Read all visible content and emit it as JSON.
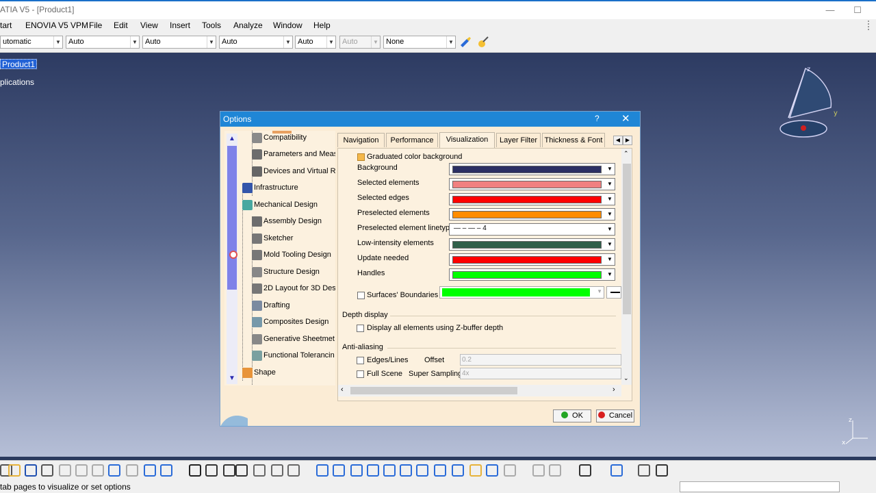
{
  "window": {
    "title": "ATIA V5 - [Product1]",
    "minimize": "—",
    "maximize": "☐"
  },
  "menubar": [
    "tart",
    "ENOVIA V5 VPM",
    "File",
    "Edit",
    "View",
    "Insert",
    "Tools",
    "Analyze",
    "Window",
    "Help"
  ],
  "toolbar_combos": [
    {
      "value": "utomatic",
      "disabled": false
    },
    {
      "value": "Auto",
      "disabled": false
    },
    {
      "value": "Auto",
      "disabled": false
    },
    {
      "value": "Auto",
      "disabled": false
    },
    {
      "value": "Auto",
      "disabled": false
    },
    {
      "value": "Auto",
      "disabled": true
    },
    {
      "value": "None",
      "disabled": false
    }
  ],
  "tree": {
    "root": "Product1",
    "applications": "plications"
  },
  "compass": {
    "z": "z",
    "y": "y"
  },
  "axes": {
    "z": "z",
    "x": "x"
  },
  "dialog": {
    "title": "Options",
    "help": "?",
    "close": "✕",
    "left_tree": [
      {
        "label": "Compatibility",
        "icon": "compatibility-icon"
      },
      {
        "label": "Parameters and Meas",
        "icon": "parameters-icon"
      },
      {
        "label": "Devices and Virtual R",
        "icon": "devices-icon"
      },
      {
        "label": "Infrastructure",
        "icon": "infrastructure-icon"
      },
      {
        "label": "Mechanical Design",
        "icon": "mechanical-design-icon"
      },
      {
        "label": "Assembly Design",
        "icon": "assembly-icon"
      },
      {
        "label": "Sketcher",
        "icon": "sketcher-icon"
      },
      {
        "label": "Mold Tooling Design",
        "icon": "mold-tooling-icon"
      },
      {
        "label": "Structure Design",
        "icon": "structure-icon"
      },
      {
        "label": "2D Layout for 3D Des",
        "icon": "layout-icon"
      },
      {
        "label": "Drafting",
        "icon": "drafting-icon"
      },
      {
        "label": "Composites Design",
        "icon": "composites-icon"
      },
      {
        "label": "Generative Sheetmet",
        "icon": "sheetmetal-icon"
      },
      {
        "label": "Functional Tolerancin",
        "icon": "tolerancing-icon"
      },
      {
        "label": "Shape",
        "icon": "shape-icon"
      }
    ],
    "tabs": [
      "Navigation",
      "Performance",
      "Visualization",
      "Layer Filter",
      "Thickness & Font"
    ],
    "active_tab": "Visualization",
    "graduated_label": "Graduated color background",
    "color_rows": [
      {
        "label": "Background",
        "color": "#2b2f63"
      },
      {
        "label": "Selected elements",
        "color": "#f08080"
      },
      {
        "label": "Selected edges",
        "color": "#ff0000"
      },
      {
        "label": "Preselected elements",
        "color": "#ff8c00"
      },
      {
        "label": "Preselected element linetype",
        "linetype": "— – — –   4"
      },
      {
        "label": "Low-intensity elements",
        "color": "#2f5f4a"
      },
      {
        "label": "Update needed",
        "color": "#ff0000"
      },
      {
        "label": "Handles",
        "color": "#00ff00"
      }
    ],
    "surfaces_label": "Surfaces' Boundaries",
    "surfaces_color": "#00ff00",
    "depth_title": "Depth display",
    "depth_option": "Display all elements using Z-buffer depth",
    "aa_title": "Anti-aliasing",
    "edges_label": "Edges/Lines",
    "offset_label": "Offset",
    "offset_value": "0.2",
    "full_scene_label": "Full Scene",
    "super_sampling_label": "Super Sampling",
    "super_sampling_value": "4x",
    "ok": "OK",
    "cancel": "Cancel"
  },
  "statusbar": {
    "text": "tab pages to visualize or set options"
  }
}
